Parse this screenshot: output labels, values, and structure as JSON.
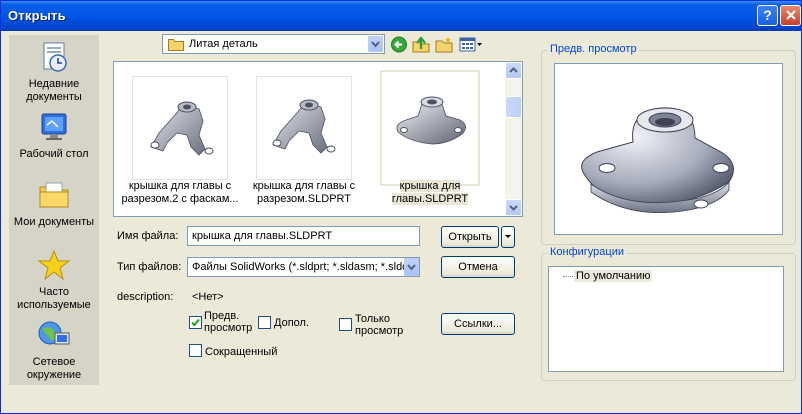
{
  "window": {
    "title": "Открыть",
    "help_label": "?"
  },
  "places": [
    {
      "label": "Недавние документы",
      "icon": "recent-documents-icon"
    },
    {
      "label": "Рабочий стол",
      "icon": "desktop-icon"
    },
    {
      "label": "Мои документы",
      "icon": "my-documents-icon"
    },
    {
      "label": "Часто используемые",
      "icon": "favorites-star-icon"
    },
    {
      "label": "Сетевое окружение",
      "icon": "network-icon"
    }
  ],
  "lookin": {
    "folder": "Литая деталь"
  },
  "files": [
    {
      "name": "крышка для главы с разрезом.2 с фаскам...",
      "selected": false
    },
    {
      "name": "крышка для главы с разрезом.SLDPRT",
      "selected": false
    },
    {
      "name": "крышка для главы.SLDPRT",
      "selected": true
    }
  ],
  "form": {
    "filename_label": "Имя файла:",
    "filename_value": "крышка для главы.SLDPRT",
    "filetype_label": "Тип файлов:",
    "filetype_value": "Файлы SolidWorks (*.sldprt; *.sldasm; *.sldd",
    "description_label": "description:",
    "description_value": "<Нет>",
    "open_button": "Открыть",
    "cancel_button": "Отмена",
    "links_button": "Ссылки...",
    "cb_preview": "Предв. просмотр",
    "cb_addl": "Допол.",
    "cb_readonly": "Только просмотр",
    "cb_short": "Сокращенный"
  },
  "preview_group": {
    "title": "Предв. просмотр"
  },
  "config_group": {
    "title": "Конфигурации",
    "items": [
      "По умолчанию"
    ]
  },
  "colors": {
    "titlebar": "#0055e5",
    "accent_label": "#0046d5"
  }
}
